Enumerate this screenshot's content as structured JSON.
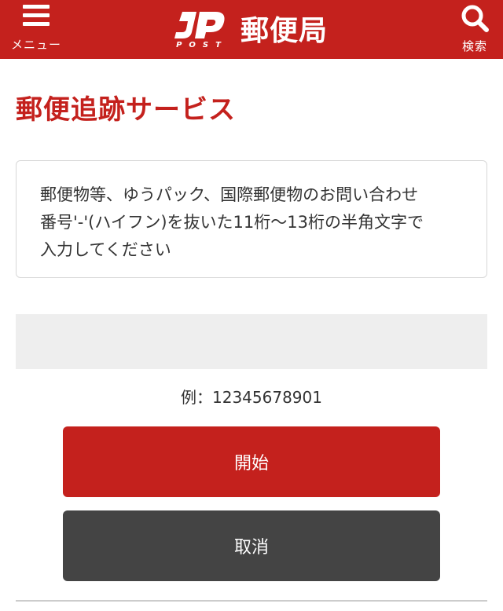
{
  "header": {
    "menu_label": "メニュー",
    "brand_name": "郵便局",
    "logo_sub": "POST",
    "search_label": "検索",
    "background_color": "#c4211d"
  },
  "page": {
    "title": "郵便追跡サービス"
  },
  "info": {
    "line1": "郵便物等、ゆうパック、国際郵便物のお問い合わせ",
    "line2": "番号'-'(ハイフン)を抜いた11桁〜13桁の半角文字で",
    "line3": "入力してください"
  },
  "tracking": {
    "value": "",
    "placeholder": "",
    "example": "例：12345678901"
  },
  "buttons": {
    "start_label": "開始",
    "cancel_label": "取消"
  },
  "icons": {
    "menu": "hamburger-icon",
    "search": "search-icon",
    "logo": "jp-post-logo"
  }
}
